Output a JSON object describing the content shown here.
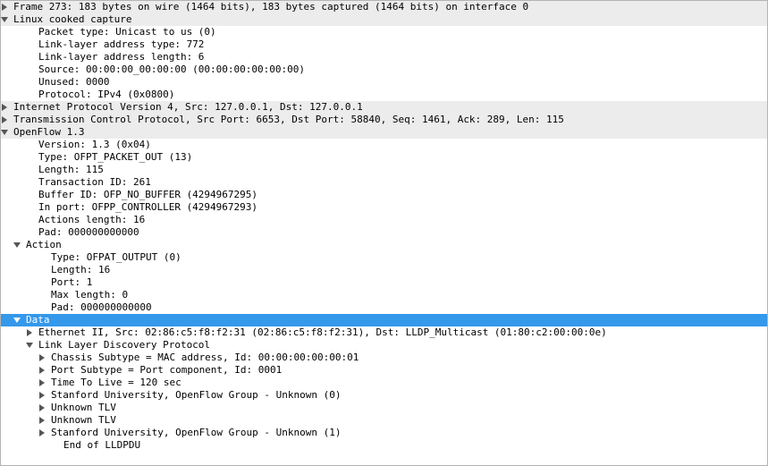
{
  "rows": [
    {
      "top": true,
      "sel": false,
      "depth_before": 0,
      "arrow": "right",
      "depth_after": 0,
      "text": "Frame 273: 183 bytes on wire (1464 bits), 183 bytes captured (1464 bits) on interface 0"
    },
    {
      "top": true,
      "sel": false,
      "depth_before": 0,
      "arrow": "down",
      "depth_after": 0,
      "text": "Linux cooked capture"
    },
    {
      "top": false,
      "sel": false,
      "depth_before": 1,
      "arrow": "none",
      "depth_after": 1,
      "text": "Packet type: Unicast to us (0)"
    },
    {
      "top": false,
      "sel": false,
      "depth_before": 1,
      "arrow": "none",
      "depth_after": 1,
      "text": "Link-layer address type: 772"
    },
    {
      "top": false,
      "sel": false,
      "depth_before": 1,
      "arrow": "none",
      "depth_after": 1,
      "text": "Link-layer address length: 6"
    },
    {
      "top": false,
      "sel": false,
      "depth_before": 1,
      "arrow": "none",
      "depth_after": 1,
      "text": "Source: 00:00:00_00:00:00 (00:00:00:00:00:00)"
    },
    {
      "top": false,
      "sel": false,
      "depth_before": 1,
      "arrow": "none",
      "depth_after": 1,
      "text": "Unused: 0000"
    },
    {
      "top": false,
      "sel": false,
      "depth_before": 1,
      "arrow": "none",
      "depth_after": 1,
      "text": "Protocol: IPv4 (0x0800)"
    },
    {
      "top": true,
      "sel": false,
      "depth_before": 0,
      "arrow": "right",
      "depth_after": 0,
      "text": "Internet Protocol Version 4, Src: 127.0.0.1, Dst: 127.0.0.1"
    },
    {
      "top": true,
      "sel": false,
      "depth_before": 0,
      "arrow": "right",
      "depth_after": 0,
      "text": "Transmission Control Protocol, Src Port: 6653, Dst Port: 58840, Seq: 1461, Ack: 289, Len: 115"
    },
    {
      "top": true,
      "sel": false,
      "depth_before": 0,
      "arrow": "down",
      "depth_after": 0,
      "text": "OpenFlow 1.3"
    },
    {
      "top": false,
      "sel": false,
      "depth_before": 1,
      "arrow": "none",
      "depth_after": 1,
      "text": "Version: 1.3 (0x04)"
    },
    {
      "top": false,
      "sel": false,
      "depth_before": 1,
      "arrow": "none",
      "depth_after": 1,
      "text": "Type: OFPT_PACKET_OUT (13)"
    },
    {
      "top": false,
      "sel": false,
      "depth_before": 1,
      "arrow": "none",
      "depth_after": 1,
      "text": "Length: 115"
    },
    {
      "top": false,
      "sel": false,
      "depth_before": 1,
      "arrow": "none",
      "depth_after": 1,
      "text": "Transaction ID: 261"
    },
    {
      "top": false,
      "sel": false,
      "depth_before": 1,
      "arrow": "none",
      "depth_after": 1,
      "text": "Buffer ID: OFP_NO_BUFFER (4294967295)"
    },
    {
      "top": false,
      "sel": false,
      "depth_before": 1,
      "arrow": "none",
      "depth_after": 1,
      "text": "In port: OFPP_CONTROLLER (4294967293)"
    },
    {
      "top": false,
      "sel": false,
      "depth_before": 1,
      "arrow": "none",
      "depth_after": 1,
      "text": "Actions length: 16"
    },
    {
      "top": false,
      "sel": false,
      "depth_before": 1,
      "arrow": "none",
      "depth_after": 1,
      "text": "Pad: 000000000000"
    },
    {
      "top": false,
      "sel": false,
      "depth_before": 1,
      "arrow": "down",
      "depth_after": 0,
      "text": "Action"
    },
    {
      "top": false,
      "sel": false,
      "depth_before": 2,
      "arrow": "none",
      "depth_after": 1,
      "text": "Type: OFPAT_OUTPUT (0)"
    },
    {
      "top": false,
      "sel": false,
      "depth_before": 2,
      "arrow": "none",
      "depth_after": 1,
      "text": "Length: 16"
    },
    {
      "top": false,
      "sel": false,
      "depth_before": 2,
      "arrow": "none",
      "depth_after": 1,
      "text": "Port: 1"
    },
    {
      "top": false,
      "sel": false,
      "depth_before": 2,
      "arrow": "none",
      "depth_after": 1,
      "text": "Max length: 0"
    },
    {
      "top": false,
      "sel": false,
      "depth_before": 2,
      "arrow": "none",
      "depth_after": 1,
      "text": "Pad: 000000000000"
    },
    {
      "top": false,
      "sel": true,
      "depth_before": 1,
      "arrow": "down",
      "depth_after": 0,
      "text": "Data"
    },
    {
      "top": false,
      "sel": false,
      "depth_before": 2,
      "arrow": "right",
      "depth_after": 0,
      "text": "Ethernet II, Src: 02:86:c5:f8:f2:31 (02:86:c5:f8:f2:31), Dst: LLDP_Multicast (01:80:c2:00:00:0e)"
    },
    {
      "top": false,
      "sel": false,
      "depth_before": 2,
      "arrow": "down",
      "depth_after": 0,
      "text": "Link Layer Discovery Protocol"
    },
    {
      "top": false,
      "sel": false,
      "depth_before": 3,
      "arrow": "right",
      "depth_after": 0,
      "text": "Chassis Subtype = MAC address, Id: 00:00:00:00:00:01"
    },
    {
      "top": false,
      "sel": false,
      "depth_before": 3,
      "arrow": "right",
      "depth_after": 0,
      "text": "Port Subtype = Port component, Id: 0001"
    },
    {
      "top": false,
      "sel": false,
      "depth_before": 3,
      "arrow": "right",
      "depth_after": 0,
      "text": "Time To Live = 120 sec"
    },
    {
      "top": false,
      "sel": false,
      "depth_before": 3,
      "arrow": "right",
      "depth_after": 0,
      "text": "Stanford University, OpenFlow Group - Unknown (0)"
    },
    {
      "top": false,
      "sel": false,
      "depth_before": 3,
      "arrow": "right",
      "depth_after": 0,
      "text": "Unknown TLV"
    },
    {
      "top": false,
      "sel": false,
      "depth_before": 3,
      "arrow": "right",
      "depth_after": 0,
      "text": "Unknown TLV"
    },
    {
      "top": false,
      "sel": false,
      "depth_before": 3,
      "arrow": "right",
      "depth_after": 0,
      "text": "Stanford University, OpenFlow Group - Unknown (1)"
    },
    {
      "top": false,
      "sel": false,
      "depth_before": 3,
      "arrow": "none",
      "depth_after": 1,
      "text": "End of LLDPDU"
    }
  ]
}
